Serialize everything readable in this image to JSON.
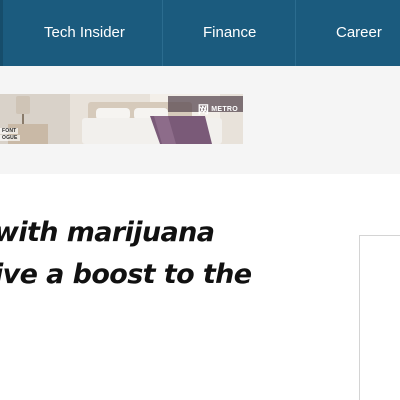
{
  "nav": {
    "items": [
      {
        "label": "Tech Insider"
      },
      {
        "label": "Finance"
      },
      {
        "label": "Career"
      }
    ],
    "background": "#1b5b7e"
  },
  "ad": {
    "caption_line1": "FONT",
    "caption_line2": "OGUE",
    "brand_mark": "网",
    "brand_text": "METRO"
  },
  "article": {
    "headline_line1": "with marijuana",
    "headline_line2": "ive a boost to the"
  }
}
